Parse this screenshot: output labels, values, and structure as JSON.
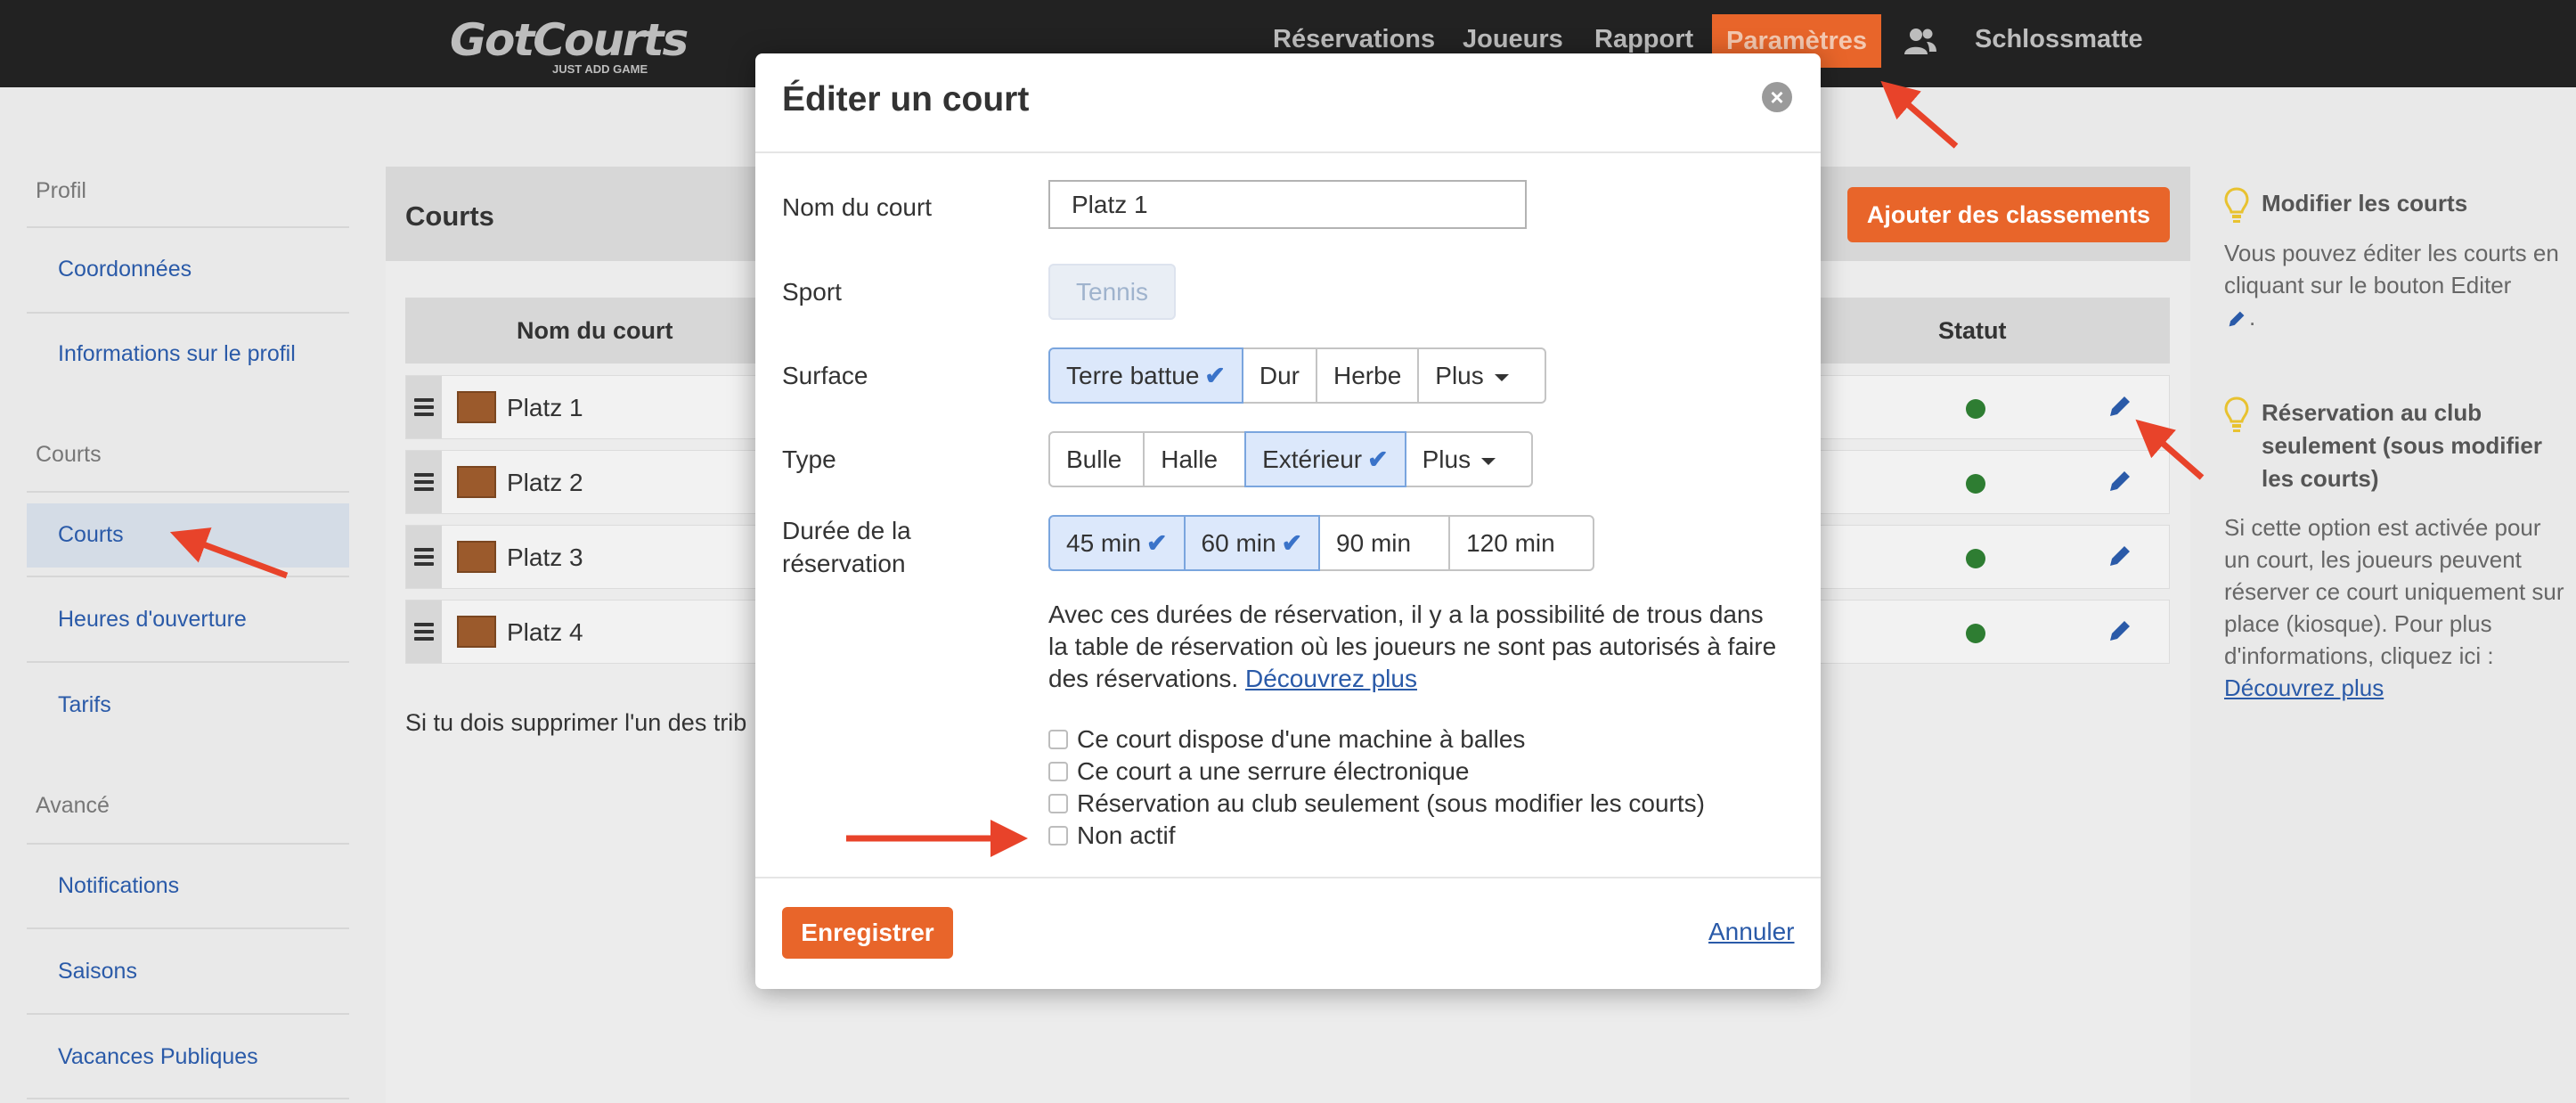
{
  "navbar": {
    "logo": "GotCourts",
    "logo_tagline": "JUST ADD GAME",
    "items": [
      "Réservations",
      "Joueurs",
      "Rapport"
    ],
    "active_item": "Paramètres",
    "user_icon": "users-icon",
    "club": "Schlossmatte"
  },
  "sidebar": {
    "groups": [
      {
        "heading": "Profil",
        "items": [
          "Coordonnées",
          "Informations sur le profil"
        ]
      },
      {
        "heading": "Courts",
        "items": [
          "Courts",
          "Heures d'ouverture",
          "Tarifs"
        ]
      },
      {
        "heading": "Avancé",
        "items": [
          "Notifications",
          "Saisons",
          "Vacances Publiques"
        ]
      }
    ],
    "active_item": "Courts"
  },
  "main": {
    "title": "Courts",
    "add_button": "Ajouter des classements",
    "columns": {
      "name": "Nom du court",
      "status": "Statut"
    },
    "rows": [
      {
        "name": "Platz 1",
        "status_color": "#2e7d32"
      },
      {
        "name": "Platz 2",
        "status_color": "#2e7d32"
      },
      {
        "name": "Platz 3",
        "status_color": "#2e7d32"
      },
      {
        "name": "Platz 4",
        "status_color": "#2e7d32"
      }
    ],
    "note": "Si tu dois supprimer l'un des trib"
  },
  "help": {
    "blocks": [
      {
        "title": "Modifier les courts",
        "text": "Vous pouvez éditer les courts en cliquant sur le bouton Editer",
        "icon": "pencil-icon",
        "trailing": "."
      },
      {
        "title": "Réservation au club seulement (sous modifier les courts)",
        "text": "Si cette option est activée pour un court, les joueurs peuvent réserver ce court uniquement sur place (kiosque). Pour plus d'informations, cliquez ici :",
        "link": "Découvrez plus"
      }
    ]
  },
  "modal": {
    "title": "Éditer un court",
    "close_icon": "close-icon",
    "fields": {
      "name_label": "Nom du court",
      "name_value": "Platz 1",
      "sport_label": "Sport",
      "sport_value": "Tennis",
      "surface_label": "Surface",
      "surface_options": [
        {
          "label": "Terre battue",
          "selected": true
        },
        {
          "label": "Dur",
          "selected": false
        },
        {
          "label": "Herbe",
          "selected": false
        },
        {
          "label": "Plus",
          "dropdown": true
        }
      ],
      "type_label": "Type",
      "type_options": [
        {
          "label": "Bulle",
          "selected": false
        },
        {
          "label": "Halle",
          "selected": false
        },
        {
          "label": "Extérieur",
          "selected": true
        },
        {
          "label": "Plus",
          "dropdown": true
        }
      ],
      "duration_label": "Durée de la réservation",
      "duration_options": [
        {
          "label": "45 min",
          "selected": true
        },
        {
          "label": "60 min",
          "selected": true
        },
        {
          "label": "90 min",
          "selected": false
        },
        {
          "label": "120 min",
          "selected": false
        }
      ],
      "info_text": "Avec ces durées de réservation, il y a la possibilité de trous dans la table de réservation où les joueurs ne sont pas autorisés à faire des réservations.",
      "info_link": "Découvrez plus",
      "checkboxes": [
        {
          "label": "Ce court dispose d'une machine à balles",
          "checked": false
        },
        {
          "label": "Ce court a une serrure électronique",
          "checked": false
        },
        {
          "label": "Réservation au club seulement (sous modifier les courts)",
          "checked": false
        },
        {
          "label": "Non actif",
          "checked": false
        }
      ]
    },
    "save_button": "Enregistrer",
    "cancel_link": "Annuler"
  },
  "colors": {
    "accent": "#e8652a",
    "annotation_arrow": "#e8432a",
    "link": "#2a5aa8"
  }
}
